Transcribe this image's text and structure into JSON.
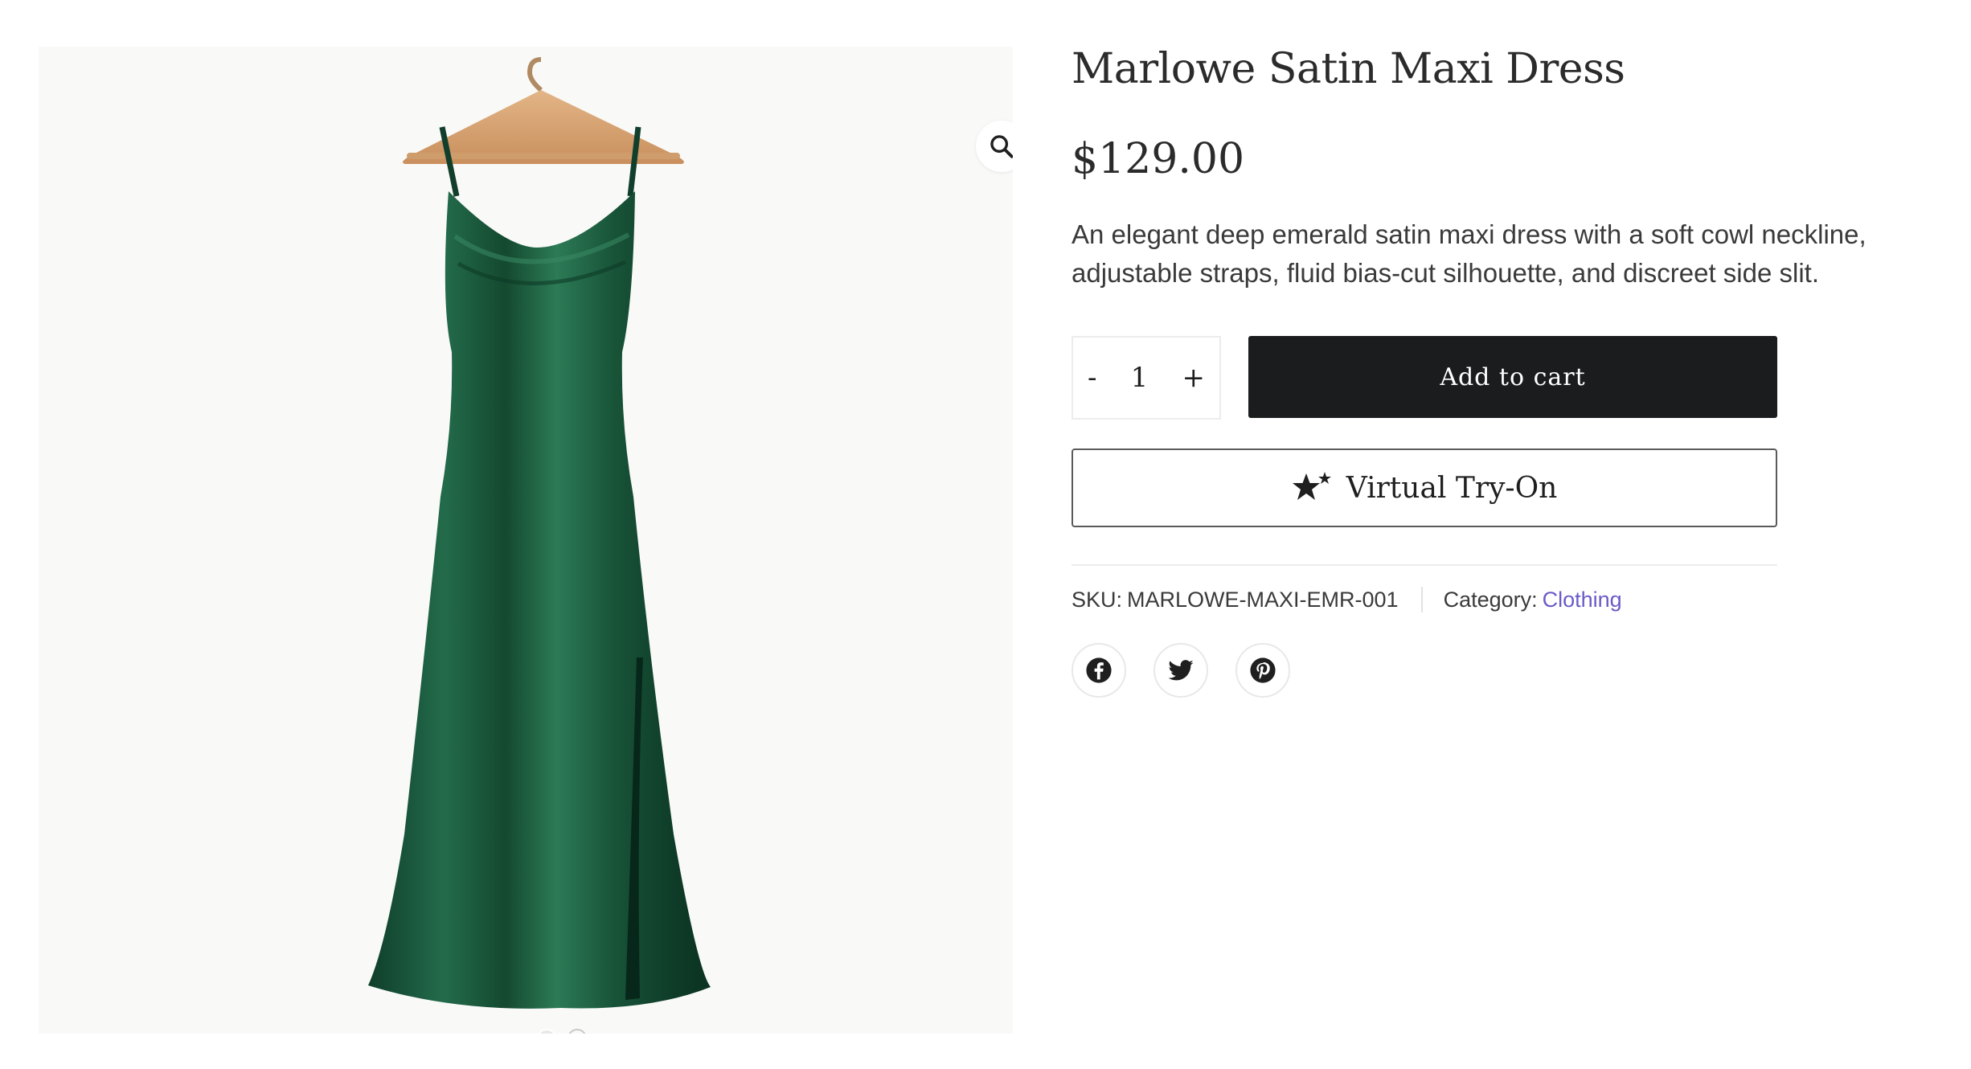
{
  "product": {
    "title": "Marlowe Satin Maxi Dress",
    "price": "$129.00",
    "description": "An elegant deep emerald satin maxi dress with a soft cowl neckline, adjustable straps, fluid bias-cut silhouette, and discreet side slit.",
    "sku_label": "SKU:",
    "sku_value": "MARLOWE-MAXI-EMR-001",
    "category_label": "Category:",
    "category_value": "Clothing"
  },
  "quantity": {
    "minus": "-",
    "value": "1",
    "plus": "+"
  },
  "actions": {
    "add_to_cart": "Add to cart",
    "virtual_tryon": "Virtual Try-On"
  },
  "gallery": {
    "image_count": 2,
    "active_index": 0
  },
  "icons": {
    "zoom": "magnifier-icon",
    "tryon": "sparkle-star-icon",
    "share": [
      "facebook-icon",
      "twitter-icon",
      "pinterest-icon"
    ]
  },
  "colors": {
    "dress": "#1d5a3f",
    "button_dark": "#1b1c1e",
    "link": "#6a5ac8",
    "hanger": "#d9a878"
  }
}
